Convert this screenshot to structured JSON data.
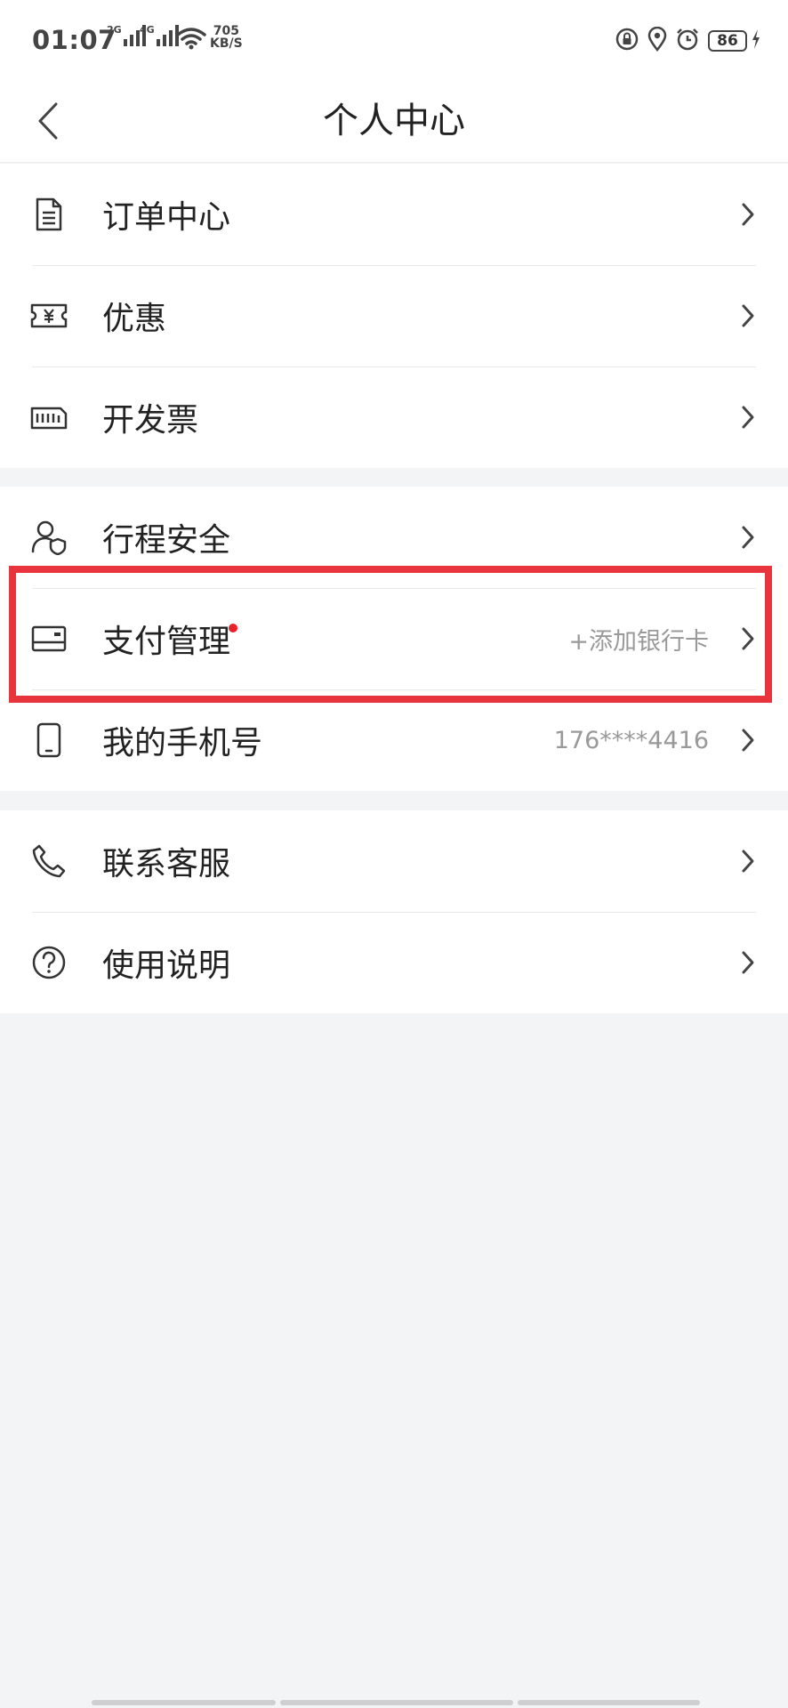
{
  "status": {
    "time": "01:07",
    "net1": "2G",
    "net2": "4G",
    "speed_value": "705",
    "speed_unit": "KB/S",
    "battery": "86"
  },
  "header": {
    "title": "个人中心"
  },
  "groups": [
    {
      "items": [
        {
          "label": "订单中心",
          "icon": "document-icon"
        },
        {
          "label": "优惠",
          "icon": "coupon-icon"
        },
        {
          "label": "开发票",
          "icon": "invoice-icon"
        }
      ]
    },
    {
      "items": [
        {
          "label": "行程安全",
          "icon": "user-shield-icon"
        },
        {
          "label": "支付管理",
          "icon": "card-icon",
          "value": "+添加银行卡",
          "badge": "red-dot"
        },
        {
          "label": "我的手机号",
          "icon": "phone-icon",
          "value": "176****4416"
        }
      ]
    },
    {
      "items": [
        {
          "label": "联系客服",
          "icon": "telephone-icon"
        },
        {
          "label": "使用说明",
          "icon": "question-icon"
        }
      ]
    }
  ],
  "colors": {
    "accent_red": "#e8343c",
    "badge_red": "#e8202a",
    "background": "#f3f4f6"
  }
}
